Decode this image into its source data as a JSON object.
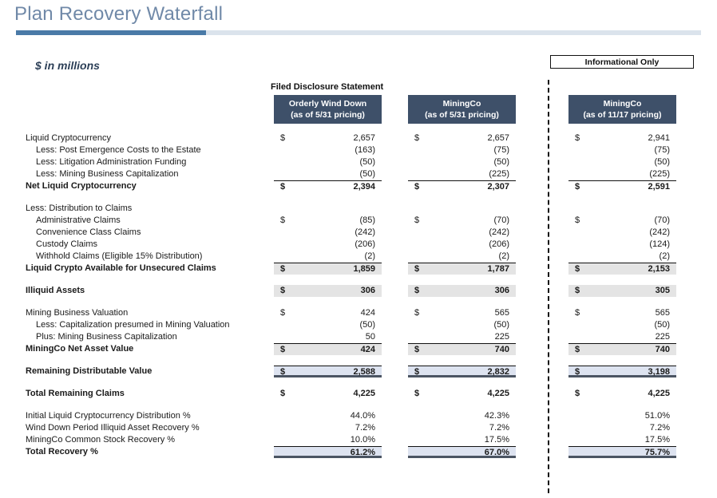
{
  "slide": {
    "title": "Plan Recovery Waterfall",
    "units_caption": "$ in millions",
    "informational_badge": "Informational Only",
    "filed_group_label": "Filed Disclosure Statement"
  },
  "colors": {
    "title_text": "#7089a8",
    "rule_dark": "#4a7aa7",
    "rule_light": "#dbe3ec",
    "header_bar": "#3e5069",
    "subtotal_gray": "#e4e4e4",
    "total_blue": "#dde3f0",
    "thick_rule": "#4b5563"
  },
  "columns": [
    {
      "id": "orderly-wind-down",
      "line1": "Orderly Wind Down",
      "line2": "(as of 5/31 pricing)"
    },
    {
      "id": "miningco-531",
      "line1": "MiningCo",
      "line2": "(as of 5/31 pricing)"
    },
    {
      "id": "miningco-1117",
      "line1": "MiningCo",
      "line2": "(as of 11/17 pricing)"
    }
  ],
  "currency_symbol": "$",
  "rows": [
    {
      "label": "Liquid Cryptocurrency",
      "indent": false,
      "bold": false,
      "values": [
        "2,657",
        "2,657",
        "2,941"
      ],
      "currency": true
    },
    {
      "label": "Less: Post Emergence Costs to the Estate",
      "indent": true,
      "bold": false,
      "values": [
        "(163)",
        "(75)",
        "(75)"
      ],
      "currency": false
    },
    {
      "label": "Less: Litigation Administration Funding",
      "indent": true,
      "bold": false,
      "values": [
        "(50)",
        "(50)",
        "(50)"
      ],
      "currency": false
    },
    {
      "label": "Less: Mining Business Capitalization",
      "indent": true,
      "bold": false,
      "values": [
        "(50)",
        "(225)",
        "(225)"
      ],
      "currency": false,
      "rule_after": true
    },
    {
      "label": "Net Liquid Cryptocurrency",
      "indent": false,
      "bold": true,
      "values": [
        "2,394",
        "2,307",
        "2,591"
      ],
      "currency": true,
      "rule_top": true
    },
    {
      "spacer": true
    },
    {
      "label": "Less: Distribution to Claims",
      "indent": false,
      "bold": false,
      "values": [
        "",
        "",
        ""
      ],
      "currency": false
    },
    {
      "label": "Administrative Claims",
      "indent": true,
      "bold": false,
      "values": [
        "(85)",
        "(70)",
        "(70)"
      ],
      "currency": true
    },
    {
      "label": "Convenience Class Claims",
      "indent": true,
      "bold": false,
      "values": [
        "(242)",
        "(242)",
        "(242)"
      ],
      "currency": false
    },
    {
      "label": "Custody Claims",
      "indent": true,
      "bold": false,
      "values": [
        "(206)",
        "(206)",
        "(124)"
      ],
      "currency": false
    },
    {
      "label": "Withhold Claims (Eligible 15% Distribution)",
      "indent": true,
      "bold": false,
      "values": [
        "(2)",
        "(2)",
        "(2)"
      ],
      "currency": false
    },
    {
      "label": "Liquid Crypto Available for Unsecured Claims",
      "indent": false,
      "bold": true,
      "values": [
        "1,859",
        "1,787",
        "2,153"
      ],
      "currency": true,
      "rule_top": true,
      "shade": "gray"
    },
    {
      "spacer": true
    },
    {
      "label": "Illiquid Assets",
      "indent": false,
      "bold": true,
      "values": [
        "306",
        "306",
        "305"
      ],
      "currency": true,
      "shade": "gray"
    },
    {
      "spacer": true
    },
    {
      "label": "Mining Business Valuation",
      "indent": false,
      "bold": false,
      "values": [
        "424",
        "565",
        "565"
      ],
      "currency": true
    },
    {
      "label": "Less: Capitalization presumed in Mining Valuation",
      "indent": true,
      "bold": false,
      "values": [
        "(50)",
        "(50)",
        "(50)"
      ],
      "currency": false
    },
    {
      "label": "Plus: Mining Business Capitalization",
      "indent": true,
      "bold": false,
      "values": [
        "50",
        "225",
        "225"
      ],
      "currency": false
    },
    {
      "label": "MiningCo Net Asset Value",
      "indent": false,
      "bold": true,
      "values": [
        "424",
        "740",
        "740"
      ],
      "currency": true,
      "rule_top": true,
      "shade": "gray"
    },
    {
      "spacer": true
    },
    {
      "label": "Remaining Distributable Value",
      "indent": false,
      "bold": true,
      "values": [
        "2,588",
        "2,832",
        "3,198"
      ],
      "currency": true,
      "rule_top": true,
      "shade": "blue",
      "rule_bottom_thick": true
    },
    {
      "spacer": true
    },
    {
      "label": "Total Remaining Claims",
      "indent": false,
      "bold": true,
      "values": [
        "4,225",
        "4,225",
        "4,225"
      ],
      "currency": true
    },
    {
      "spacer": true
    },
    {
      "label": "Initial Liquid Cryptocurrency Distribution %",
      "indent": false,
      "bold": false,
      "values": [
        "44.0%",
        "42.3%",
        "51.0%"
      ],
      "currency": false
    },
    {
      "label": "Wind Down Period Illiquid Asset Recovery %",
      "indent": false,
      "bold": false,
      "values": [
        "7.2%",
        "7.2%",
        "7.2%"
      ],
      "currency": false
    },
    {
      "label": "MiningCo Common Stock Recovery %",
      "indent": false,
      "bold": false,
      "values": [
        "10.0%",
        "17.5%",
        "17.5%"
      ],
      "currency": false
    },
    {
      "label": "Total Recovery %",
      "indent": false,
      "bold": true,
      "values": [
        "61.2%",
        "67.0%",
        "75.7%"
      ],
      "currency": false,
      "rule_top": true,
      "shade": "blue",
      "rule_bottom_thick": true
    }
  ]
}
